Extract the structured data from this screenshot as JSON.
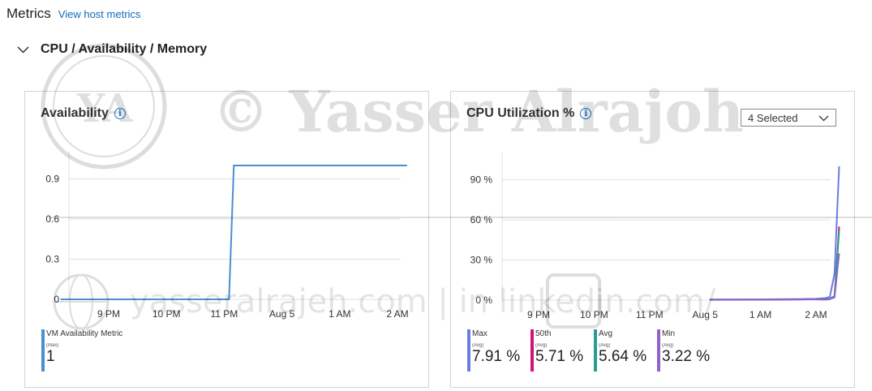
{
  "header": {
    "title": "Metrics",
    "link": "View host metrics"
  },
  "section": {
    "title": "CPU / Availability / Memory"
  },
  "availability": {
    "title": "Availability",
    "ticks_y": [
      "0.9",
      "0.6",
      "0.3",
      "0"
    ],
    "ticks_x": [
      "9 PM",
      "10 PM",
      "11 PM",
      "Aug 5",
      "1 AM",
      "2 AM"
    ],
    "legend": {
      "name": "VM Availability Metric",
      "agg": "(Max)",
      "value": "1",
      "color": "#4a90d0"
    }
  },
  "cpu": {
    "title": "CPU Utilization %",
    "selector": "4 Selected",
    "ticks_y": [
      "90 %",
      "60 %",
      "30 %",
      "0 %"
    ],
    "ticks_x": [
      "9 PM",
      "10 PM",
      "11 PM",
      "Aug 5",
      "1 AM",
      "2 AM"
    ],
    "legend": [
      {
        "name": "Max",
        "agg": "(Avg)",
        "value": "7.91 %",
        "color": "#6b7de0"
      },
      {
        "name": "50th",
        "agg": "(Avg)",
        "value": "5.71 %",
        "color": "#d0157a"
      },
      {
        "name": "Avg",
        "agg": "(Avg)",
        "value": "5.64 %",
        "color": "#2a9d8f"
      },
      {
        "name": "Min",
        "agg": "(Avg)",
        "value": "3.22 %",
        "color": "#9063c8"
      }
    ]
  },
  "watermark": {
    "logo": "YA",
    "copyright": "©  Yasser Alrajoh",
    "line": "yasseralrajeh.com  |  in  linkedin.com/"
  },
  "chart_data": [
    {
      "type": "line",
      "title": "Availability",
      "x": [
        "8:10 PM",
        "11:05 PM",
        "11:10 PM",
        "2:10 AM"
      ],
      "series": [
        {
          "name": "VM Availability Metric",
          "values": [
            0,
            0,
            1,
            1
          ]
        }
      ],
      "ylim": [
        0,
        1
      ],
      "xlabel": "",
      "ylabel": "",
      "grid": true
    },
    {
      "type": "line",
      "title": "CPU Utilization %",
      "x": [
        "12:05 AM",
        "1:00 AM",
        "1:45 AM",
        "2:00 AM",
        "2:10 AM",
        "2:15 AM",
        "2:20 AM",
        "2:25 AM"
      ],
      "series": [
        {
          "name": "Max",
          "values": [
            0.5,
            0.5,
            0.8,
            1.0,
            1.5,
            2.5,
            20,
            100
          ]
        },
        {
          "name": "50th",
          "values": [
            0.3,
            0.4,
            0.6,
            0.8,
            0.6,
            1.0,
            3,
            55
          ]
        },
        {
          "name": "Avg",
          "values": [
            0.3,
            0.4,
            0.6,
            0.8,
            0.6,
            1.0,
            3,
            52
          ]
        },
        {
          "name": "Min",
          "values": [
            0.2,
            0.3,
            0.5,
            0.7,
            0.4,
            0.8,
            2,
            35
          ]
        }
      ],
      "ylim": [
        0,
        100
      ],
      "xlabel": "",
      "ylabel": "",
      "grid": true
    }
  ]
}
